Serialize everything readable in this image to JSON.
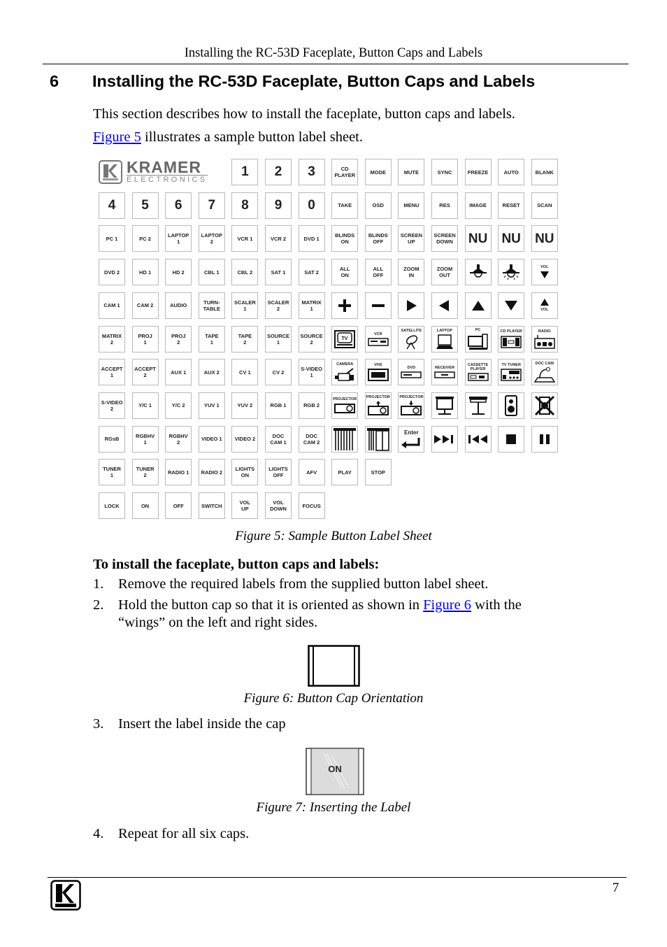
{
  "running_head": "Installing the RC-53D Faceplate, Button Caps and Labels",
  "section": {
    "number": "6",
    "title": "Installing the RC-53D Faceplate, Button Caps and Labels"
  },
  "intro": {
    "line1": "This section describes how to install the faceplate, button caps and labels.",
    "line2_link": "Figure 5",
    "line2_rest": " illustrates a sample button label sheet."
  },
  "label_sheet": {
    "logo": {
      "brand": "KRAMER",
      "sub": "ELECTRONICS",
      "icon": "kramer-k-logo-icon"
    },
    "rows": [
      [
        null,
        null,
        null,
        null,
        "1",
        "2",
        "3",
        "CD\nPLAYER",
        "MODE",
        "MUTE",
        "SYNC",
        "FREEZE",
        "AUTO",
        "BLANK"
      ],
      [
        "4",
        "5",
        "6",
        "7",
        "8",
        "9",
        "0",
        "TAKE",
        "OSD",
        "MENU",
        "RES",
        "IMAGE",
        "RESET",
        "SCAN"
      ],
      [
        "PC 1",
        "PC 2",
        "LAPTOP\n1",
        "LAPTOP\n2",
        "VCR 1",
        "VCR 2",
        "DVD 1",
        "BLINDS\nON",
        "BLINDS\nOFF",
        "SCREEN\nUP",
        "SCREEN\nDOWN",
        "NU",
        "NU",
        "NU"
      ],
      [
        "DVD 2",
        "HD 1",
        "HD 2",
        "CBL 1",
        "CBL 2",
        "SAT 1",
        "SAT 2",
        "ALL\nON",
        "ALL\nOFF",
        "ZOOM\nIN",
        "ZOOM\nOUT",
        "icon:lamp-off",
        "icon:lamp-on",
        "icon:vol-down"
      ],
      [
        "CAM 1",
        "CAM 2",
        "AUDIO",
        "TURN-\nTABLE",
        "SCALER\n1",
        "SCALER\n2",
        "MATRIX\n1",
        "icon:plus",
        "icon:minus",
        "icon:right",
        "icon:left",
        "icon:up",
        "icon:down",
        "icon:vol-up"
      ],
      [
        "MATRIX\n2",
        "PROJ\n1",
        "PROJ\n2",
        "TAPE\n1",
        "TAPE\n2",
        "SOURCE\n1",
        "SOURCE\n2",
        "icon:tv",
        "icon:vcr",
        "icon:satellite",
        "icon:laptop",
        "icon:pc",
        "icon:cd-player",
        "icon:radio"
      ],
      [
        "ACCEPT\n1",
        "ACCEPT\n2",
        "AUX 1",
        "AUX 2",
        "CV 1",
        "CV 2",
        "S-VIDEO\n1",
        "icon:camera",
        "icon:vhs",
        "icon:dvd",
        "icon:receiver",
        "icon:cassette-player",
        "icon:tv-tuner",
        "icon:doc-cam"
      ],
      [
        "S-VIDEO\n2",
        "Y/C 1",
        "Y/C 2",
        "YUV 1",
        "YUV 2",
        "RGB 1",
        "RGB 2",
        "icon:projector",
        "icon:projector-up",
        "icon:projector-down",
        "icon:screen",
        "icon:screen-stand",
        "icon:speaker",
        "icon:speaker-mute"
      ],
      [
        "RGsB",
        "RGBHV\n1",
        "RGBHV\n2",
        "VIDEO 1",
        "VIDEO 2",
        "DOC\nCAM 1",
        "DOC\nCAM 2",
        "icon:blinds-closed",
        "icon:blinds-open",
        "icon:enter",
        "icon:next",
        "icon:previous",
        "icon:stop",
        "icon:pause"
      ],
      [
        "TUNER\n1",
        "TUNER\n2",
        "RADIO 1",
        "RADIO 2",
        "LIGHTS\nON",
        "LIGHTS\nOFF",
        "AFV",
        "PLAY",
        "STOP",
        null,
        null,
        null,
        null,
        null
      ],
      [
        "LOCK",
        "ON",
        "OFF",
        "SWITCH",
        "VOL\nUP",
        "VOL\nDOWN",
        "FOCUS",
        null,
        null,
        null,
        null,
        null,
        null,
        null
      ]
    ],
    "icon_captions": {
      "tv": "TV",
      "vcr": "VCR",
      "satellite": "SATELLITE",
      "laptop": "LAPTOP",
      "pc": "PC",
      "cd-player": "CD PLAYER",
      "radio": "RADIO",
      "camera": "CAMERA",
      "vhs": "VHS",
      "dvd": "DVD",
      "receiver": "RECEIVER",
      "cassette-player": "CASSETTE PLAYER",
      "tv-tuner": "TV TUNER",
      "doc-cam": "DOC CAM",
      "projector": "PROJECTOR",
      "projector-up": "PROJECTOR",
      "projector-down": "PROJECTOR",
      "vol-down": "VOL",
      "vol-up": "VOL",
      "enter": "Enter"
    }
  },
  "figure5_caption": "Figure 5: Sample Button Label Sheet",
  "procedure": {
    "heading": "To install the faceplate, button caps and labels:",
    "steps": [
      {
        "n": "1.",
        "text": "Remove the required labels from the supplied button label sheet."
      },
      {
        "n": "2.",
        "text_before": "Hold the button cap so that it is oriented as shown in ",
        "link": "Figure 6",
        "text_after": " with the",
        "line2": "“wings” on the left and right sides."
      },
      {
        "n": "3.",
        "text": "Insert the label inside the cap"
      },
      {
        "n": "4.",
        "text": "Repeat for all six caps."
      }
    ]
  },
  "figure6_caption": "Figure 6: Button Cap Orientation",
  "figure7": {
    "label": "ON",
    "caption": "Figure 7: Inserting the Label"
  },
  "footer": {
    "page_number": "7",
    "logo_icon": "kramer-k-logo-icon"
  }
}
